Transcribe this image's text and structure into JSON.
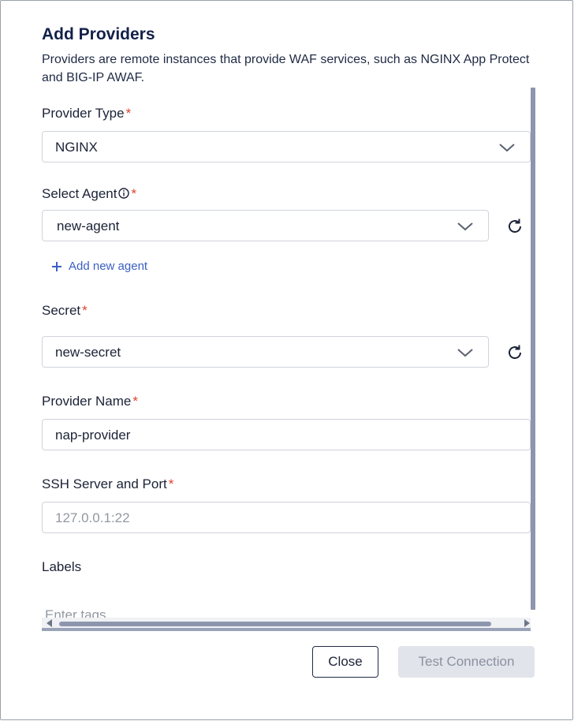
{
  "dialog": {
    "title": "Add Providers",
    "description": "Providers are remote instances that provide WAF services, such as NGINX App Protect and BIG-IP AWAF."
  },
  "form": {
    "provider_type": {
      "label": "Provider Type",
      "required_mark": "*",
      "value": "NGINX"
    },
    "select_agent": {
      "label": "Select Agent",
      "required_mark": "*",
      "value": "new-agent",
      "info_icon": "info-icon",
      "refresh_icon": "refresh-icon"
    },
    "add_agent": {
      "label": "Add new agent",
      "icon": "plus-icon"
    },
    "secret": {
      "label": "Secret",
      "required_mark": "*",
      "value": "new-secret",
      "refresh_icon": "refresh-icon"
    },
    "provider_name": {
      "label": "Provider Name",
      "required_mark": "*",
      "value": "nap-provider"
    },
    "ssh_server": {
      "label": "SSH Server and Port",
      "required_mark": "*",
      "placeholder": "127.0.0.1:22"
    },
    "labels": {
      "label": "Labels",
      "placeholder": "Enter tags"
    }
  },
  "buttons": {
    "close": "Close",
    "test_connection": "Test Connection"
  },
  "colors": {
    "title": "#13204a",
    "required": "#e0412e",
    "link": "#3a5fc4",
    "disabled_button_bg": "#e1e4ea",
    "scrollbar": "#8d96ad"
  }
}
